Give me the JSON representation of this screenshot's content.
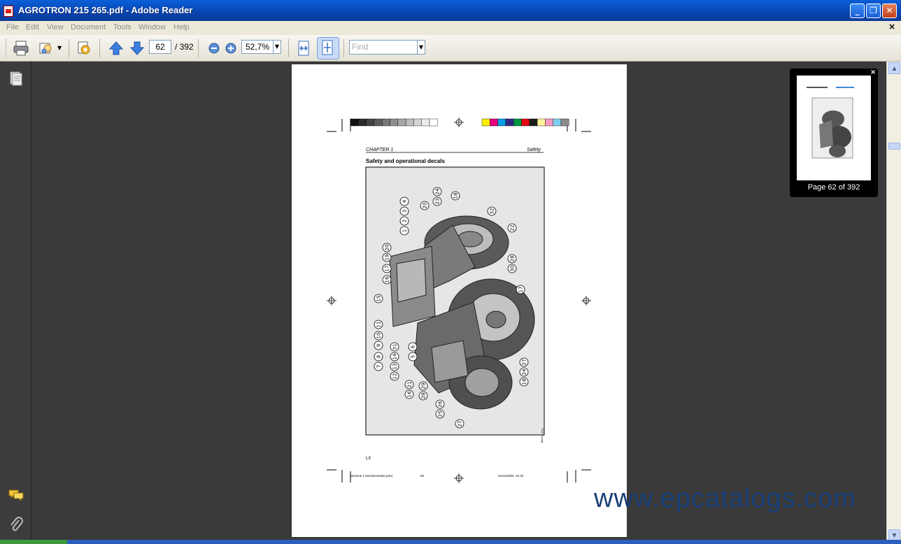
{
  "window": {
    "title": "AGROTRON 215 265.pdf - Adobe Reader",
    "minimize": "_",
    "maximize": "❐",
    "close": "✕"
  },
  "menu": {
    "items": [
      "File",
      "Edit",
      "View",
      "Document",
      "Tools",
      "Window",
      "Help"
    ],
    "doc_close": "×"
  },
  "toolbar": {
    "page_current": "62",
    "page_total": "/ 392",
    "zoom": "52,7%",
    "find_placeholder": "Find",
    "dropdown_arrow": "▼"
  },
  "document": {
    "header_left": "CHAPTER 1",
    "header_right": "Safety",
    "section_title": "Safety and operational decals",
    "page_footer_code": "LX",
    "slug_file": "Sezione 1 Decalcomanie.pmd",
    "slug_page": "60",
    "slug_date": "21/12/2004, 10.43",
    "figure_code": "TS47-0.png",
    "callouts": [
      "1",
      "2",
      "3",
      "4",
      "20",
      "23",
      "24",
      "18",
      "32",
      "22",
      "20",
      "19",
      "17",
      "16",
      "30",
      "28",
      "15",
      "17",
      "11",
      "10",
      "9",
      "8",
      "7",
      "31",
      "14",
      "13",
      "12",
      "6",
      "5",
      "21",
      "16",
      "29",
      "28",
      "25",
      "26",
      "27",
      "18",
      "24",
      "27"
    ]
  },
  "thumbnail": {
    "caption": "Page 62 of 392",
    "close": "×"
  },
  "scrollbar": {
    "up": "▲",
    "down": "▼"
  },
  "watermark": "www.epcatalogs.com",
  "colors": {
    "titlebar": "#0a5fd8",
    "doc_bg": "#3a3a3a",
    "watermark": "#173e78"
  }
}
